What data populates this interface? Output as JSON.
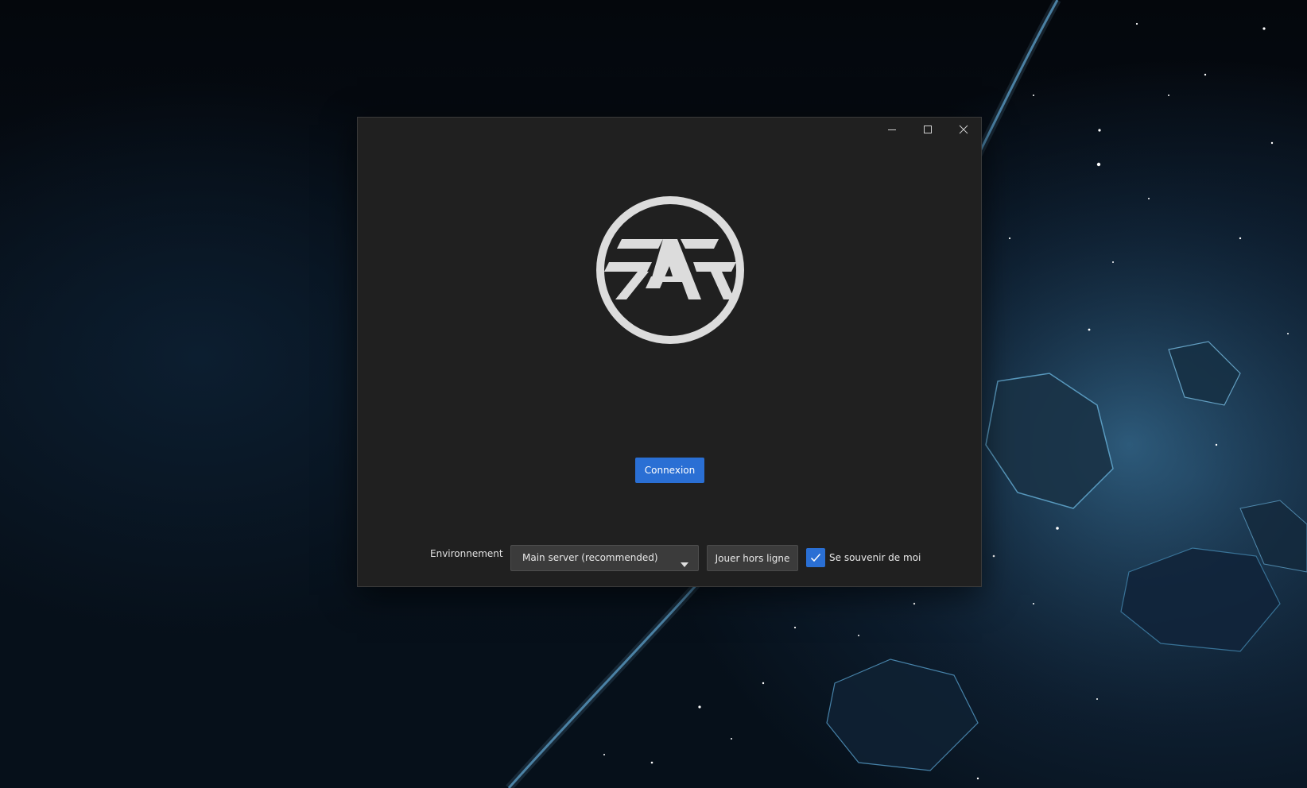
{
  "window": {
    "controls": {
      "minimize_icon": "minimize-icon",
      "maximize_icon": "maximize-icon",
      "close_icon": "close-icon"
    },
    "logo_text": "FAF"
  },
  "login": {
    "button_label": "Connexion"
  },
  "footer": {
    "environment_label": "Environnement",
    "environment_selected": "Main server (recommended)",
    "offline_button_label": "Jouer hors ligne",
    "remember_me_label": "Se souvenir de moi",
    "remember_me_checked": true
  },
  "colors": {
    "accent": "#2a6fd4",
    "window_bg": "#202020",
    "control_bg": "#3b3b3b",
    "logo": "#dcdcdc"
  }
}
